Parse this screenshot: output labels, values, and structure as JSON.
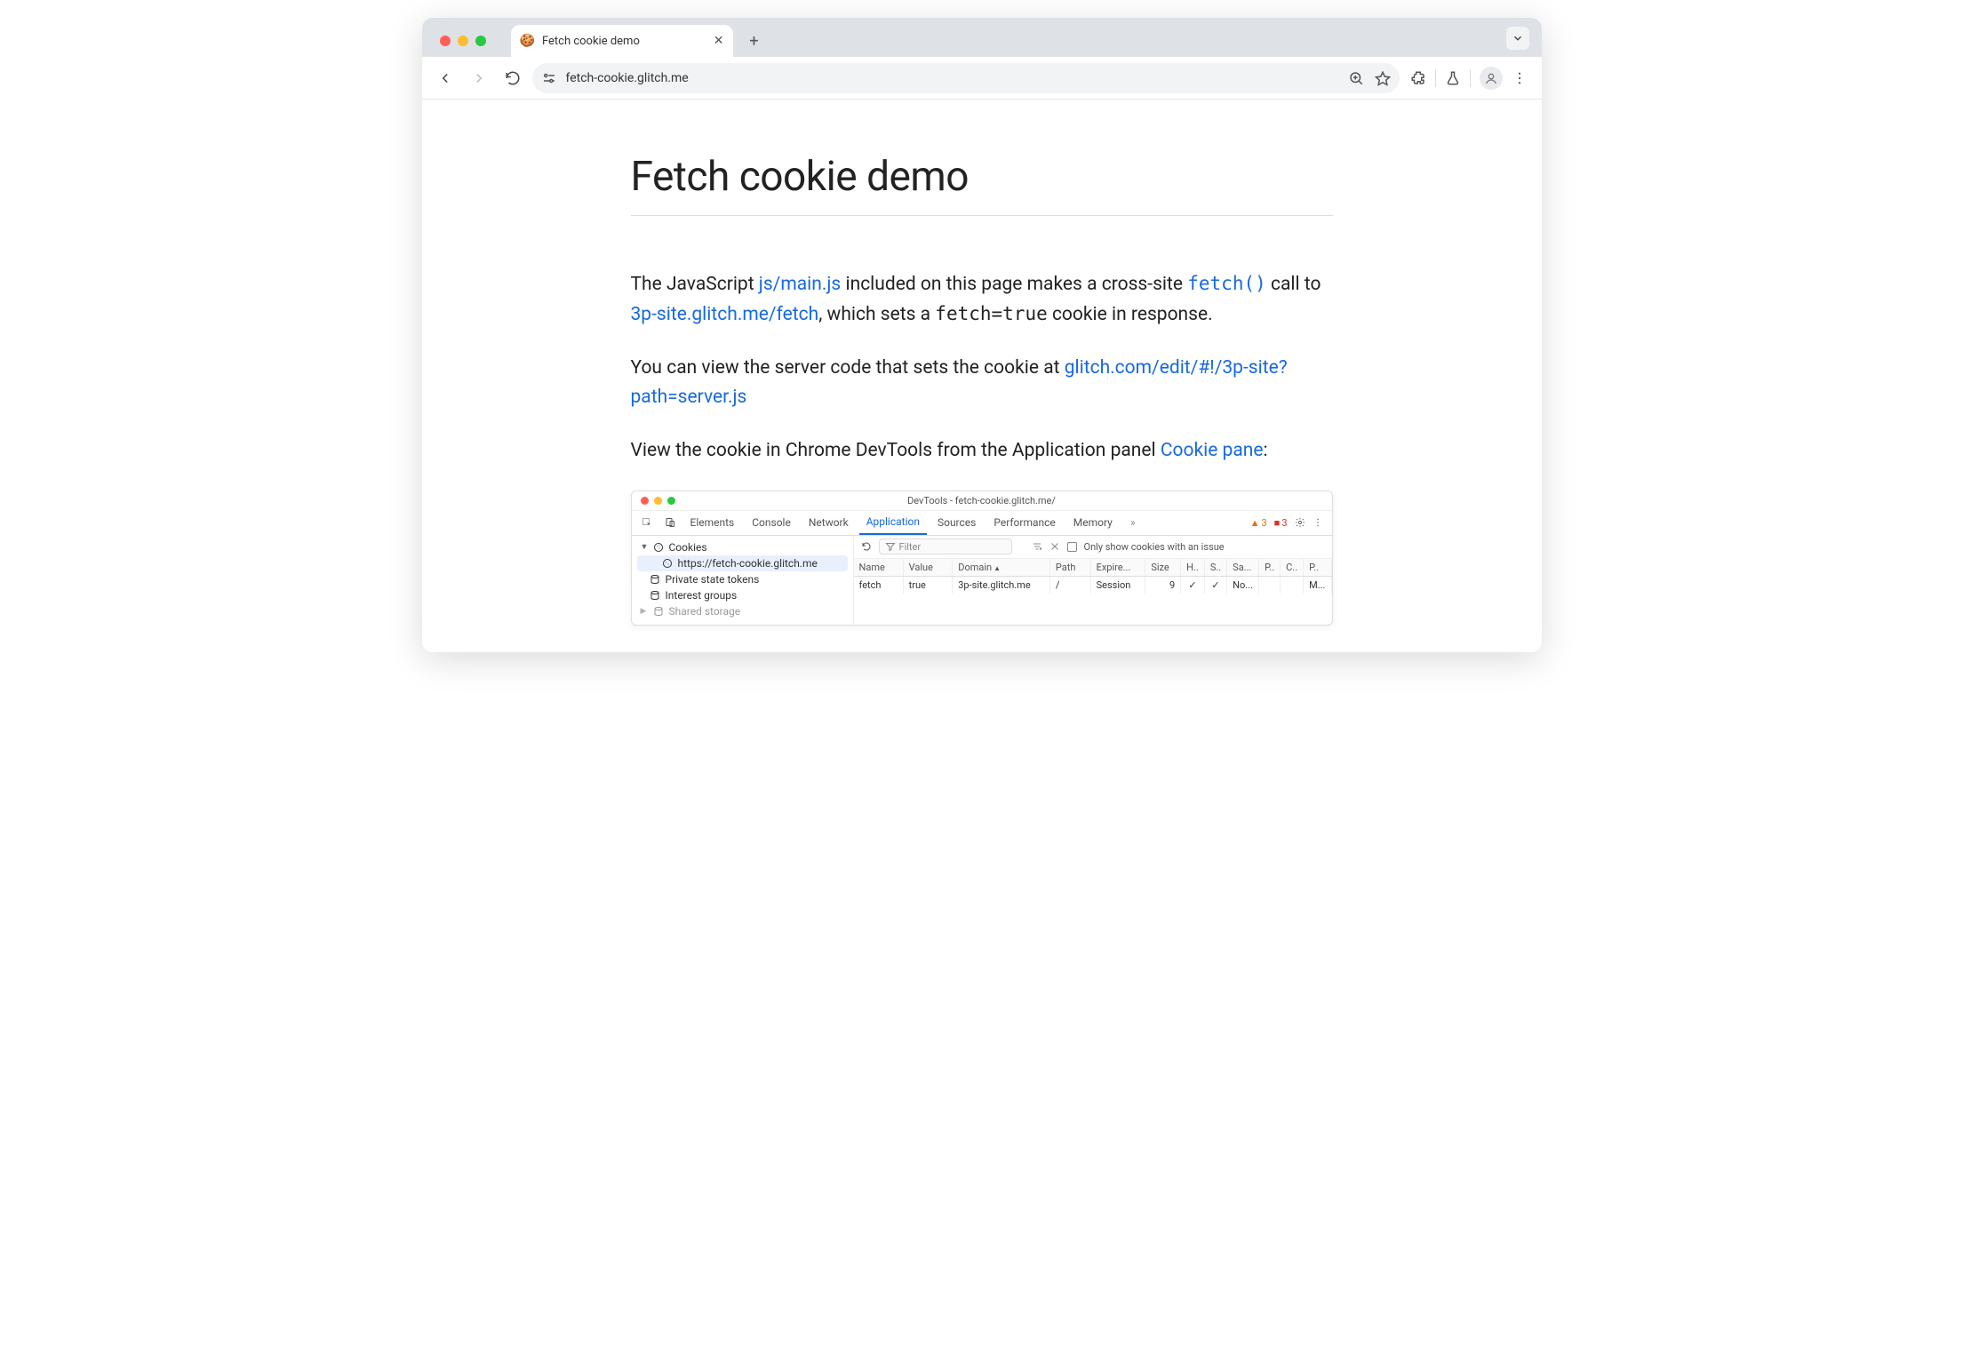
{
  "browser": {
    "tab_title": "Fetch cookie demo",
    "favicon": "🍪",
    "url": "fetch-cookie.glitch.me"
  },
  "page": {
    "heading": "Fetch cookie demo",
    "p1_a": "The JavaScript ",
    "p1_link1": "js/main.js",
    "p1_b": " included on this page makes a cross-site ",
    "p1_code_link": "fetch()",
    "p1_c": " call to ",
    "p1_link2": "3p-site.glitch.me/fetch",
    "p1_d": ", which sets a ",
    "p1_code": "fetch=true",
    "p1_e": " cookie in response.",
    "p2_a": "You can view the server code that sets the cookie at ",
    "p2_link": "glitch.com/edit/#!/3p-site?path=server.js",
    "p3_a": "View the cookie in Chrome DevTools from the Application panel ",
    "p3_link": "Cookie pane",
    "p3_b": ":"
  },
  "devtools": {
    "title": "DevTools - fetch-cookie.glitch.me/",
    "tabs": [
      "Elements",
      "Console",
      "Network",
      "Application",
      "Sources",
      "Performance",
      "Memory"
    ],
    "active_tab": "Application",
    "warnings": "3",
    "errors": "3",
    "sidebar": {
      "cookies_label": "Cookies",
      "cookie_origin": "https://fetch-cookie.glitch.me",
      "private_state": "Private state tokens",
      "interest_groups": "Interest groups",
      "shared_storage": "Shared storage"
    },
    "filter": {
      "placeholder": "Filter",
      "only_issues": "Only show cookies with an issue"
    },
    "columns": [
      "Name",
      "Value",
      "Domain",
      "Path",
      "Expire...",
      "Size",
      "H..",
      "S..",
      "Sa...",
      "P..",
      "C..",
      "P.."
    ],
    "row": {
      "name": "fetch",
      "value": "true",
      "domain": "3p-site.glitch.me",
      "path": "/",
      "expires": "Session",
      "size": "9",
      "http": "✓",
      "secure": "✓",
      "samesite": "No...",
      "partition": "",
      "cross": "",
      "priority": "M..."
    }
  }
}
